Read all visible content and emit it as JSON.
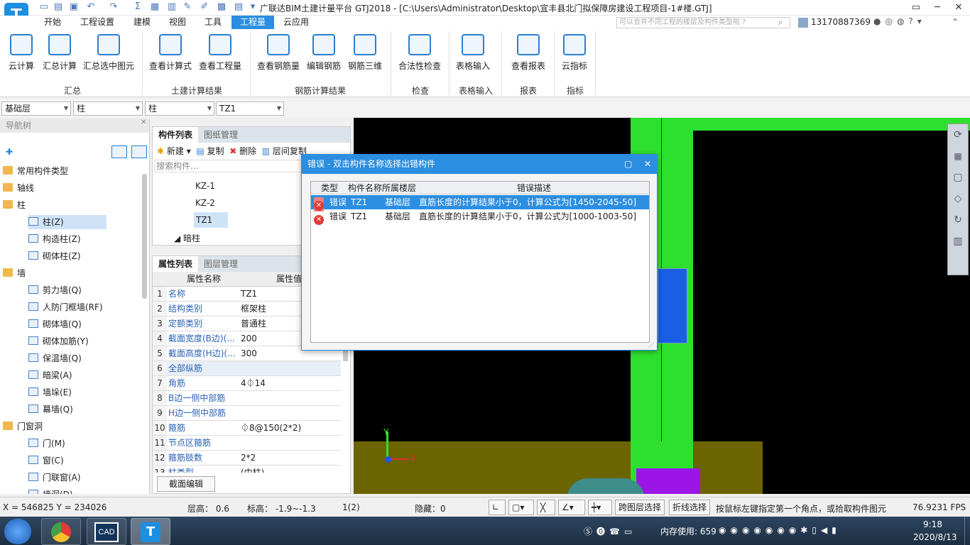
{
  "window": {
    "title": "广联达BIM土建计量平台 GTJ2018 - [C:\\Users\\Administrator\\Desktop\\宜丰县北门拟保障房建设工程项目-1#楼.GTJ]",
    "app_logo": "T"
  },
  "menu": [
    "开始",
    "工程设置",
    "建模",
    "视图",
    "工具",
    "工程量",
    "云应用"
  ],
  "menu_active": "工程量",
  "search": {
    "placeholder": "可以合并不同工程的楼层及构件类型啦 ?"
  },
  "user": {
    "phone": "13170887369"
  },
  "ribbon": {
    "buttons": [
      "云计算",
      "汇总计算",
      "汇总选中图元",
      "查看计算式",
      "查看工程量",
      "查看钢筋量",
      "编辑钢筋",
      "钢筋三维",
      "合法性检查",
      "表格输入",
      "查看报表",
      "云指标"
    ],
    "groups": [
      "汇总",
      "土建计算结果",
      "钢筋计算结果",
      "检查",
      "表格输入",
      "报表",
      "指标"
    ]
  },
  "filters": [
    "基础层",
    "柱",
    "柱",
    "TZ1"
  ],
  "nav": {
    "title": "导航树",
    "items": [
      {
        "label": "常用构件类型",
        "level": 0,
        "icon": "folder-icon"
      },
      {
        "label": "轴线",
        "level": 0,
        "icon": "folder-icon"
      },
      {
        "label": "柱",
        "level": 0,
        "icon": "folder-icon"
      },
      {
        "label": "柱(Z)",
        "level": 1,
        "icon": "column-icon",
        "selected": true
      },
      {
        "label": "构造柱(Z)",
        "level": 1,
        "icon": "constructional-column-icon"
      },
      {
        "label": "砌体柱(Z)",
        "level": 1,
        "icon": "masonry-column-icon"
      },
      {
        "label": "墙",
        "level": 0,
        "icon": "folder-icon"
      },
      {
        "label": "剪力墙(Q)",
        "level": 1,
        "icon": "shear-wall-icon"
      },
      {
        "label": "人防门框墙(RF)",
        "level": 1,
        "icon": "door-frame-wall-icon"
      },
      {
        "label": "砌体墙(Q)",
        "level": 1,
        "icon": "masonry-wall-icon"
      },
      {
        "label": "砌体加筋(Y)",
        "level": 1,
        "icon": "masonry-reinforcement-icon"
      },
      {
        "label": "保温墙(Q)",
        "level": 1,
        "icon": "insulation-wall-icon"
      },
      {
        "label": "暗梁(A)",
        "level": 1,
        "icon": "hidden-beam-icon"
      },
      {
        "label": "墙垛(E)",
        "level": 1,
        "icon": "wall-pier-icon"
      },
      {
        "label": "幕墙(Q)",
        "level": 1,
        "icon": "curtain-wall-icon"
      },
      {
        "label": "门窗洞",
        "level": 0,
        "icon": "folder-icon"
      },
      {
        "label": "门(M)",
        "level": 1,
        "icon": "door-icon"
      },
      {
        "label": "窗(C)",
        "level": 1,
        "icon": "window-icon"
      },
      {
        "label": "门联窗(A)",
        "level": 1,
        "icon": "door-window-icon"
      },
      {
        "label": "墙洞(D)",
        "level": 1,
        "icon": "wall-hole-icon"
      }
    ]
  },
  "components": {
    "tabs": [
      "构件列表",
      "图纸管理"
    ],
    "toolbar": [
      "新建",
      "复制",
      "删除",
      "层间复制"
    ],
    "search_placeholder": "搜索构件...",
    "items": [
      "KZ-1",
      "KZ-2",
      "TZ1"
    ],
    "group": "暗柱",
    "selected": "TZ1"
  },
  "properties": {
    "tabs": [
      "属性列表",
      "图层管理"
    ],
    "headers": [
      "属性名称",
      "属性值"
    ],
    "rows": [
      {
        "n": "1",
        "k": "名称",
        "v": "TZ1"
      },
      {
        "n": "2",
        "k": "结构类别",
        "v": "框架柱"
      },
      {
        "n": "3",
        "k": "定额类别",
        "v": "普通柱"
      },
      {
        "n": "4",
        "k": "截面宽度(B边)(...",
        "v": "200"
      },
      {
        "n": "5",
        "k": "截面高度(H边)(...",
        "v": "300"
      },
      {
        "n": "6",
        "k": "全部纵筋",
        "v": ""
      },
      {
        "n": "7",
        "k": "角筋",
        "v": "4⏀14"
      },
      {
        "n": "8",
        "k": "B边一侧中部筋",
        "v": ""
      },
      {
        "n": "9",
        "k": "H边一侧中部筋",
        "v": ""
      },
      {
        "n": "10",
        "k": "箍筋",
        "v": "⏀8@150(2*2)"
      },
      {
        "n": "11",
        "k": "节点区箍筋",
        "v": ""
      },
      {
        "n": "12",
        "k": "箍筋肢数",
        "v": "2*2"
      },
      {
        "n": "13",
        "k": "柱类型",
        "v": "(中柱)"
      }
    ],
    "edit_button": "截面编辑"
  },
  "dialog": {
    "title": "错误 - 双击构件名称选择出错构件",
    "headers": [
      "类型",
      "构件名称",
      "所属楼层",
      "错误描述"
    ],
    "rows": [
      {
        "type": "错误",
        "name": "TZ1",
        "floor": "基础层",
        "desc": "直筋长度的计算结果小于0，计算公式为[1450-2045-50]"
      },
      {
        "type": "错误",
        "name": "TZ1",
        "floor": "基础层",
        "desc": "直筋长度的计算结果小于0，计算公式为[1000-1003-50]"
      }
    ]
  },
  "status": {
    "coords": "X = 546825 Y = 234026",
    "floor_height": "层高： 0.6",
    "elevation": "标高：  -1.9~-1.3",
    "count": "1(2)",
    "hidden": "隐藏：0",
    "cross_layer": "跨图层选择",
    "polyline": "折线选择",
    "hint": "按鼠标左键指定第一个角点，或拾取构件图元",
    "fps": "76.9231 FPS"
  },
  "taskbar": {
    "memory": "内存使用: 659",
    "time": "9:18",
    "date": "2020/8/13",
    "cad_label": "CAD"
  }
}
